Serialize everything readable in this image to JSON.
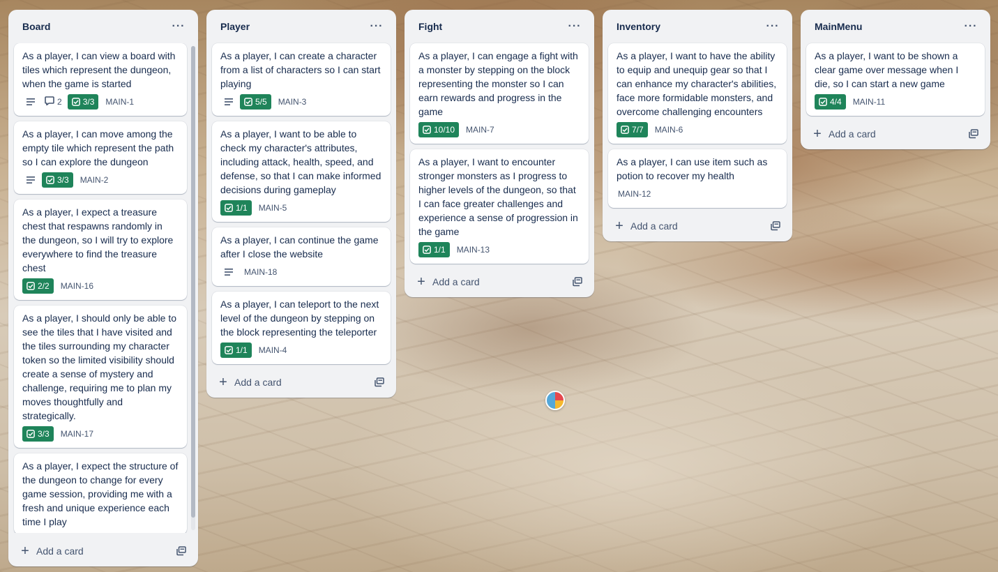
{
  "lists": [
    {
      "title": "Board",
      "add_label": "Add a card",
      "cards": [
        {
          "title": "As a player, I can view a board with tiles which represent the dungeon, when the game is started",
          "has_description": true,
          "comments": "2",
          "checklist": "3/3",
          "key": "MAIN-1"
        },
        {
          "title": "As a player, I can move among the empty tile which represent the path so I can explore the dungeon",
          "has_description": true,
          "checklist": "3/3",
          "key": "MAIN-2"
        },
        {
          "title": "As a player, I expect a treasure chest that respawns randomly in the dungeon, so I will try to explore everywhere to find the treasure chest",
          "checklist": "2/2",
          "key": "MAIN-16"
        },
        {
          "title": "As a player, I should only be able to see the tiles that I have visited and the tiles surrounding my character token so the limited visibility should create a sense of mystery and challenge, requiring me to plan my moves thoughtfully and strategically.",
          "checklist": "3/3",
          "key": "MAIN-17"
        },
        {
          "title": "As a player, I expect the structure of the dungeon to change for every game session, providing me with a fresh and unique experience each time I play"
        }
      ]
    },
    {
      "title": "Player",
      "add_label": "Add a card",
      "cards": [
        {
          "title": "As a player, I can create a character from a list of characters so I can start playing",
          "has_description": true,
          "checklist": "5/5",
          "key": "MAIN-3"
        },
        {
          "title": "As a player, I want to be able to check my character's attributes, including attack, health, speed, and defense, so that I can make informed decisions during gameplay",
          "checklist": "1/1",
          "key": "MAIN-5"
        },
        {
          "title": "As a player, I can continue the game after I close the website",
          "has_description": true,
          "key": "MAIN-18"
        },
        {
          "title": "As a player, I can teleport to the next level of the dungeon by stepping on the block representing the teleporter",
          "checklist": "1/1",
          "key": "MAIN-4"
        }
      ]
    },
    {
      "title": "Fight",
      "add_label": "Add a card",
      "cards": [
        {
          "title": "As a player, I can engage a fight with a monster by stepping on the block representing the monster so I can earn rewards and progress in the game",
          "checklist": "10/10",
          "key": "MAIN-7"
        },
        {
          "title": "As a player, I want to encounter stronger monsters as I progress to higher levels of the dungeon, so that I can face greater challenges and experience a sense of progression in the game",
          "checklist": "1/1",
          "key": "MAIN-13"
        }
      ]
    },
    {
      "title": "Inventory",
      "add_label": "Add a card",
      "cards": [
        {
          "title": "As a player, I want to have the ability to equip and unequip gear so that I can enhance my character's abilities, face more formidable monsters, and overcome challenging encounters",
          "checklist": "7/7",
          "key": "MAIN-6"
        },
        {
          "title": "As a player, I can use item such as potion to recover my health",
          "key": "MAIN-12"
        }
      ]
    },
    {
      "title": "MainMenu",
      "add_label": "Add a card",
      "cards": [
        {
          "title": "As a player, I want to be shown a clear game over message when I die, so I can start a new game",
          "checklist": "4/4",
          "key": "MAIN-11"
        }
      ]
    }
  ],
  "colors": {
    "list_bg": "#f1f2f4",
    "card_bg": "#ffffff",
    "checklist_complete": "#1f845a",
    "text_primary": "#172b4d",
    "text_secondary": "#44546f"
  },
  "icons": {
    "list_menu": "ellipsis-icon",
    "description": "description-lines-icon",
    "comments": "comment-icon",
    "checklist": "checkbox-icon",
    "add": "plus-icon",
    "template": "card-template-icon"
  }
}
